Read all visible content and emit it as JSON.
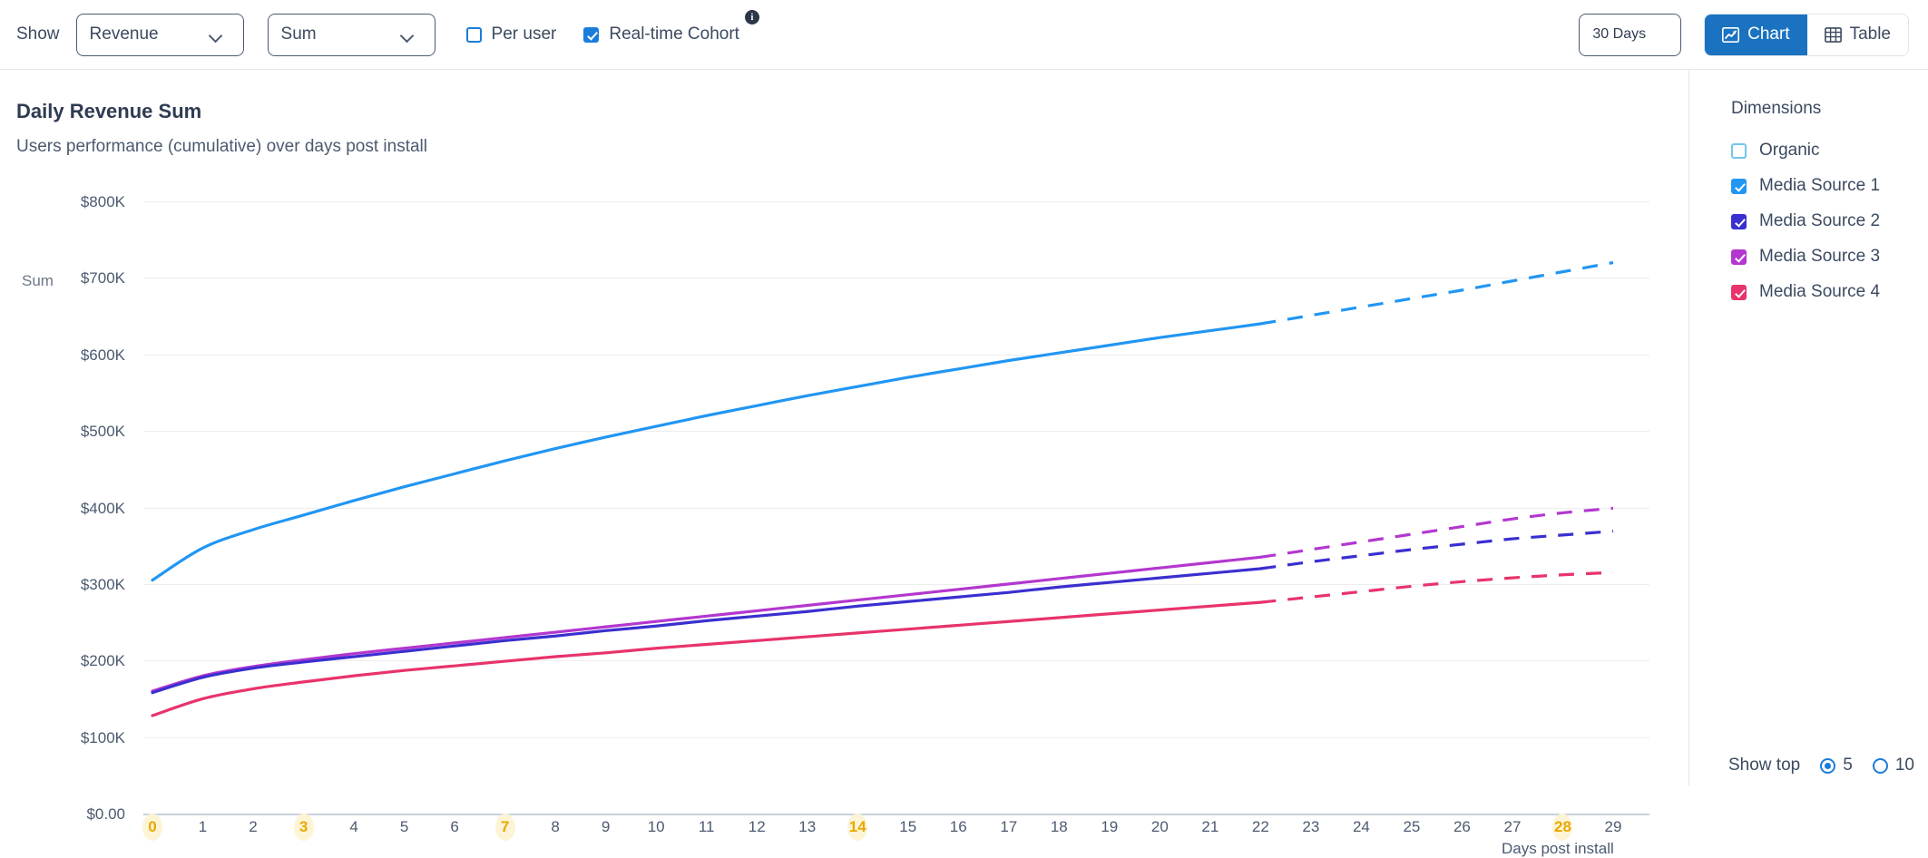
{
  "toolbar": {
    "show_label": "Show",
    "metric_select": {
      "value": "Revenue",
      "icon": "chevron-down-icon"
    },
    "agg_select": {
      "value": "Sum",
      "icon": "chevron-down-icon"
    },
    "per_user": {
      "label": "Per user",
      "checked": false
    },
    "realtime_cohort": {
      "label": "Real-time Cohort",
      "checked": true,
      "info_glyph": "i"
    },
    "range_select": {
      "value": "30 Days",
      "icon": "chevron-down-icon"
    },
    "view_chart": {
      "label": "Chart",
      "icon": "line-chart-icon",
      "active": true
    },
    "view_table": {
      "label": "Table",
      "icon": "table-grid-icon",
      "active": false
    },
    "accent_color": "#1a72c0"
  },
  "chart_header": {
    "title": "Daily Revenue Sum",
    "subtitle": "Users performance (cumulative) over days post install"
  },
  "sidebar": {
    "dimensions_title": "Dimensions",
    "items": [
      {
        "label": "Organic",
        "checked": false,
        "color": "#73c5e8"
      },
      {
        "label": "Media Source 1",
        "checked": true,
        "color": "#2196f3"
      },
      {
        "label": "Media Source 2",
        "checked": true,
        "color": "#3a2fd0"
      },
      {
        "label": "Media Source 3",
        "checked": true,
        "color": "#b337cf"
      },
      {
        "label": "Media Source 4",
        "checked": true,
        "color": "#e8336b"
      }
    ],
    "show_top": {
      "label": "Show top",
      "options": [
        "5",
        "10"
      ],
      "selected": "5"
    }
  },
  "chart_data": {
    "type": "line",
    "title": "Daily Revenue Sum",
    "subtitle": "Users performance (cumulative) over days post install",
    "xlabel": "Days post install",
    "ylabel": "Sum",
    "ylim": [
      0,
      800000
    ],
    "ytick_labels": [
      "$800K",
      "$700K",
      "$600K",
      "$500K",
      "$400K",
      "$300K",
      "$200K",
      "$100K",
      "$0.00"
    ],
    "ytick_values": [
      800000,
      700000,
      600000,
      500000,
      400000,
      300000,
      200000,
      100000,
      0
    ],
    "grid": true,
    "legend_position": "right-sidebar",
    "x": [
      0,
      1,
      2,
      3,
      4,
      5,
      6,
      7,
      8,
      9,
      10,
      11,
      12,
      13,
      14,
      15,
      16,
      17,
      18,
      19,
      20,
      21,
      22,
      23,
      24,
      25,
      26,
      27,
      28,
      29
    ],
    "x_highlighted": [
      0,
      3,
      7,
      14,
      28
    ],
    "forecast_starts_at_x": 22,
    "forecast_style": "dashed",
    "series": [
      {
        "name": "Media Source 1",
        "color": "#2196f3",
        "values": [
          305000,
          347000,
          371000,
          390000,
          409000,
          427000,
          444000,
          461000,
          477000,
          492000,
          506000,
          520000,
          533000,
          546000,
          558000,
          570000,
          581000,
          592000,
          602000,
          612000,
          622000,
          631000,
          640000,
          651000,
          662000,
          673000,
          684000,
          696000,
          708000,
          720000
        ]
      },
      {
        "name": "Media Source 3",
        "color": "#b337cf",
        "values": [
          160000,
          180000,
          192000,
          201000,
          209000,
          216000,
          223000,
          230000,
          237000,
          244000,
          251000,
          258000,
          265000,
          272000,
          279000,
          286000,
          293000,
          300000,
          307000,
          314000,
          321000,
          328000,
          335000,
          345000,
          355000,
          365000,
          375000,
          385000,
          393000,
          399000
        ]
      },
      {
        "name": "Media Source 2",
        "color": "#3a2fd0",
        "values": [
          158000,
          178000,
          190000,
          198000,
          205000,
          212000,
          219000,
          226000,
          232000,
          239000,
          245000,
          252000,
          258000,
          264000,
          271000,
          277000,
          283000,
          289000,
          296000,
          302000,
          308000,
          314000,
          320000,
          329000,
          337000,
          345000,
          352000,
          359000,
          364000,
          369000
        ]
      },
      {
        "name": "Media Source 4",
        "color": "#e8336b",
        "values": [
          128000,
          150000,
          163000,
          172000,
          180000,
          187000,
          193000,
          199000,
          205000,
          210000,
          216000,
          221000,
          226000,
          231000,
          236000,
          241000,
          246000,
          251000,
          256000,
          261000,
          266000,
          271000,
          276000,
          283000,
          290000,
          297000,
          303000,
          308000,
          312000,
          315000
        ]
      }
    ]
  }
}
